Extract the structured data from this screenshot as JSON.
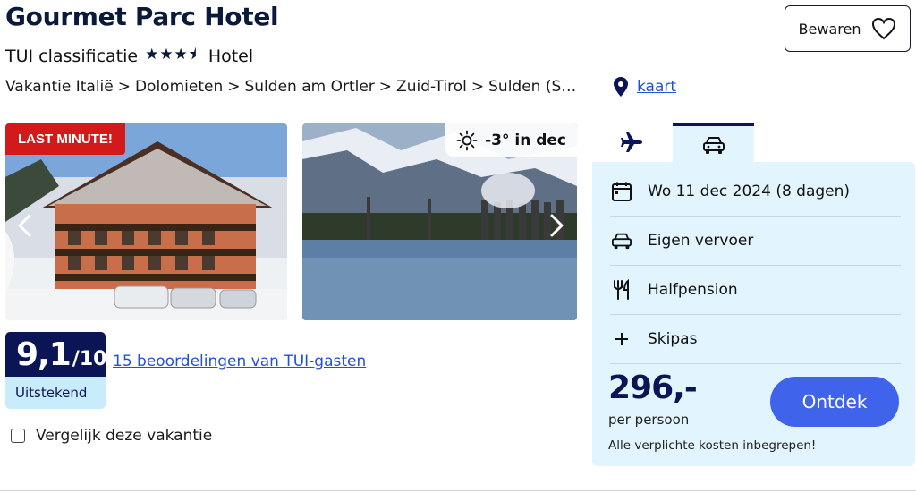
{
  "hotel": {
    "name": "Gourmet Parc Hotel",
    "classification_label": "TUI classificatie",
    "stars_glyph": "★★★⯨",
    "stars": 3.5,
    "type": "Hotel"
  },
  "breadcrumb": [
    "Vakantie Italië",
    "Dolomieten",
    "Sulden am Ortler",
    "Zuid-Tirol",
    "Sulden (S…"
  ],
  "breadcrumb_separator": ">",
  "map_link": "kaart",
  "save_button": "Bewaren",
  "gallery": {
    "badge": "LAST MINUTE!",
    "weather": "-3° in dec",
    "weather_icon": "sun-icon"
  },
  "rating": {
    "score": "9,1",
    "scale": "/10",
    "label": "Uitstekend",
    "reviews_link": "15 beoordelingen van TUI-gasten"
  },
  "compare_label": "Vergelijk deze vakantie",
  "booking": {
    "tabs": [
      {
        "icon": "airplane-icon",
        "active": false
      },
      {
        "icon": "car-icon",
        "active": true
      }
    ],
    "details": [
      {
        "icon": "calendar-icon",
        "text": "Wo 11 dec 2024 (8 dagen)"
      },
      {
        "icon": "car-icon",
        "text": "Eigen vervoer"
      },
      {
        "icon": "cutlery-icon",
        "text": "Halfpension"
      },
      {
        "icon": "plus-icon",
        "text": "Skipas"
      }
    ],
    "price": "296,-",
    "per_person": "per persoon",
    "included_note": "Alle verplichte kosten inbegrepen!",
    "cta": "Ontdek"
  },
  "colors": {
    "brand_navy": "#0b1556",
    "link_blue": "#2251d6",
    "cta_blue": "#3f63ea",
    "badge_red": "#d21a1a",
    "panel_bg": "#e2f4fd"
  }
}
